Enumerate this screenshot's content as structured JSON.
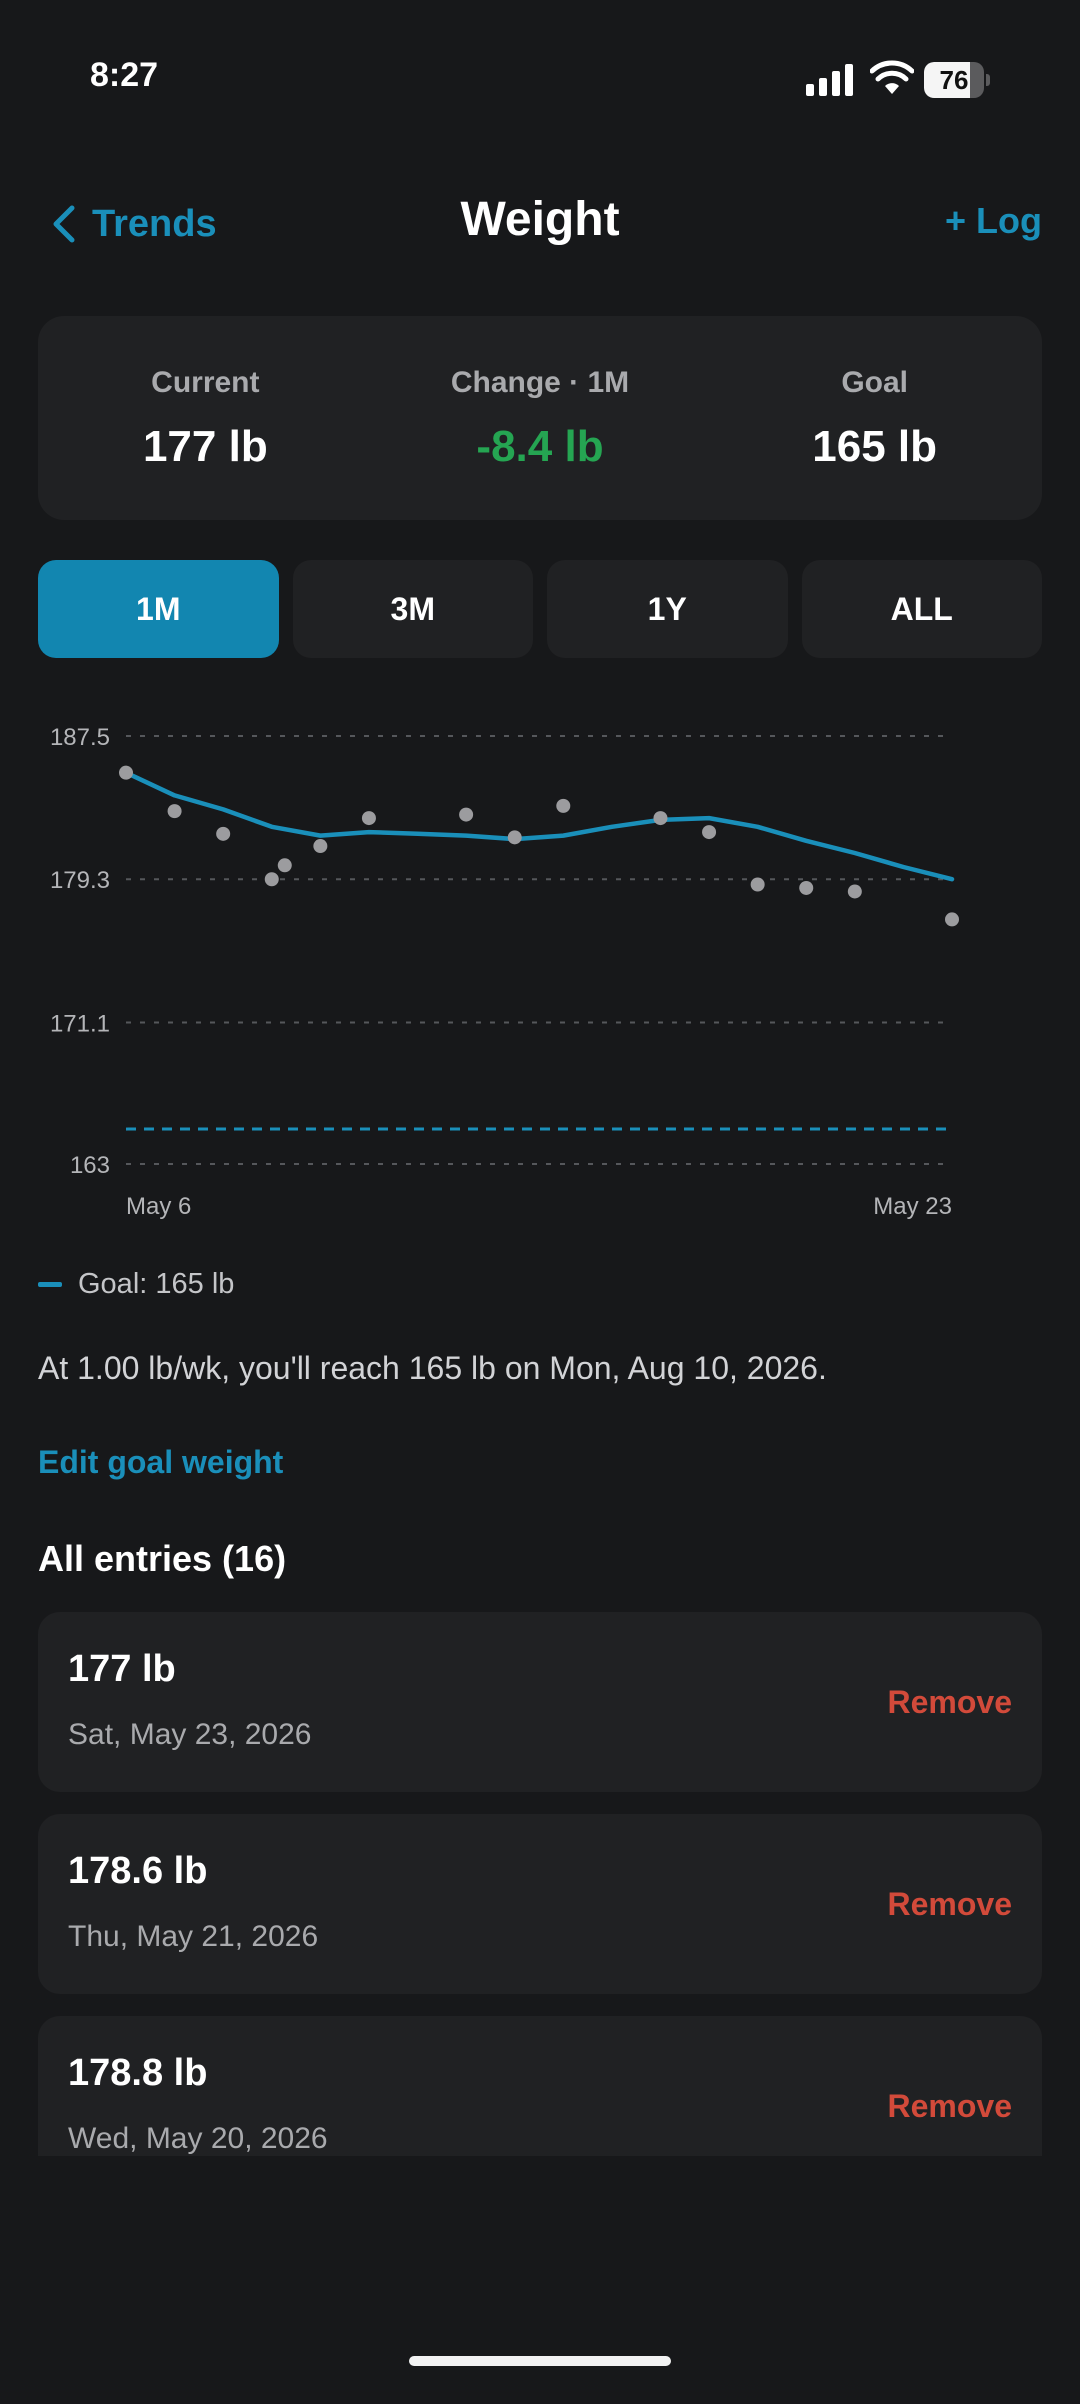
{
  "status_bar": {
    "time": "8:27",
    "battery_level": "76",
    "battery_fraction": 0.76
  },
  "nav": {
    "back_label": "Trends",
    "title": "Weight",
    "log_label": "+ Log"
  },
  "summary": {
    "current_label": "Current",
    "current_value": "177 lb",
    "change_label": "Change · 1M",
    "change_value": "-8.4 lb",
    "goal_label": "Goal",
    "goal_value": "165 lb"
  },
  "ranges": [
    {
      "label": "1M",
      "active": true
    },
    {
      "label": "3M",
      "active": false
    },
    {
      "label": "1Y",
      "active": false
    },
    {
      "label": "ALL",
      "active": false
    }
  ],
  "chart_data": {
    "type": "line",
    "y_ticks": [
      "187.5",
      "179.3",
      "171.1",
      "163"
    ],
    "ylim": [
      163,
      187.5
    ],
    "x_tick_labels": [
      "May 6",
      "May 23"
    ],
    "xlim": [
      "2026-05-06",
      "2026-05-23"
    ],
    "goal_line": 165,
    "grid": true,
    "series": [
      {
        "kind": "scatter",
        "points": [
          {
            "x": "2026-05-06",
            "y": 185.4
          },
          {
            "x": "2026-05-07",
            "y": 183.2
          },
          {
            "x": "2026-05-08",
            "y": 181.9
          },
          {
            "x": "2026-05-09",
            "y": 179.3
          },
          {
            "x": "2026-05-09",
            "y": 180.1
          },
          {
            "x": "2026-05-10",
            "y": 181.2
          },
          {
            "x": "2026-05-11",
            "y": 182.8
          },
          {
            "x": "2026-05-13",
            "y": 183.0
          },
          {
            "x": "2026-05-14",
            "y": 181.7
          },
          {
            "x": "2026-05-15",
            "y": 183.5
          },
          {
            "x": "2026-05-17",
            "y": 182.8
          },
          {
            "x": "2026-05-18",
            "y": 182.0
          },
          {
            "x": "2026-05-19",
            "y": 179.0
          },
          {
            "x": "2026-05-20",
            "y": 178.8
          },
          {
            "x": "2026-05-21",
            "y": 178.6
          },
          {
            "x": "2026-05-23",
            "y": 177.0
          }
        ]
      },
      {
        "kind": "trend",
        "points": [
          {
            "x": "2026-05-06",
            "y": 185.4
          },
          {
            "x": "2026-05-07",
            "y": 184.1
          },
          {
            "x": "2026-05-08",
            "y": 183.3
          },
          {
            "x": "2026-05-09",
            "y": 182.3
          },
          {
            "x": "2026-05-10",
            "y": 181.8
          },
          {
            "x": "2026-05-11",
            "y": 182.0
          },
          {
            "x": "2026-05-12",
            "y": 181.9
          },
          {
            "x": "2026-05-13",
            "y": 181.8
          },
          {
            "x": "2026-05-14",
            "y": 181.6
          },
          {
            "x": "2026-05-15",
            "y": 181.8
          },
          {
            "x": "2026-05-16",
            "y": 182.3
          },
          {
            "x": "2026-05-17",
            "y": 182.7
          },
          {
            "x": "2026-05-18",
            "y": 182.8
          },
          {
            "x": "2026-05-19",
            "y": 182.3
          },
          {
            "x": "2026-05-20",
            "y": 181.5
          },
          {
            "x": "2026-05-21",
            "y": 180.8
          },
          {
            "x": "2026-05-22",
            "y": 180.0
          },
          {
            "x": "2026-05-23",
            "y": 179.3
          }
        ]
      }
    ],
    "colors": {
      "trend": "#1a8fba",
      "points": "#9c9c9f",
      "goal": "#1a8fba",
      "grid": "#55575b"
    }
  },
  "legend": {
    "goal_label": "Goal: 165 lb"
  },
  "projection_text": "At 1.00 lb/wk, you'll reach 165 lb on Mon, Aug 10, 2026.",
  "edit_goal_label": "Edit goal weight",
  "entries_title": "All entries (16)",
  "entries": [
    {
      "weight": "177 lb",
      "date": "Sat, May 23, 2026",
      "remove_label": "Remove"
    },
    {
      "weight": "178.6 lb",
      "date": "Thu, May 21, 2026",
      "remove_label": "Remove"
    },
    {
      "weight": "178.8 lb",
      "date": "Wed, May 20, 2026",
      "remove_label": "Remove"
    }
  ]
}
